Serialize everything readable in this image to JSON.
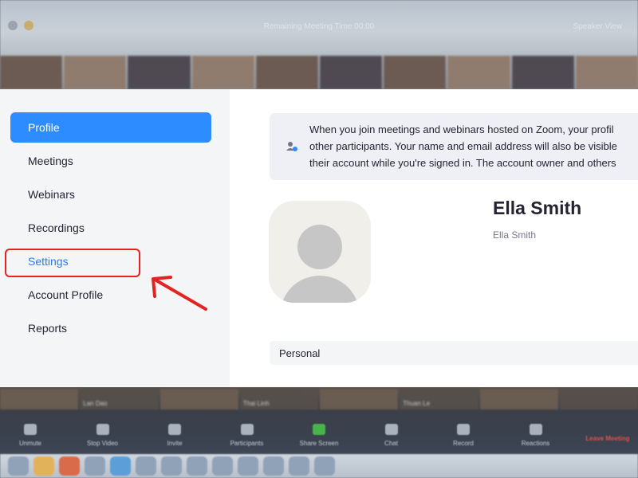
{
  "background": {
    "window_title": "Remaining Meeting Time 00:00",
    "view_label": "Speaker View",
    "strip_names": [
      "",
      "Lan Dao",
      "",
      "Thai Linh",
      "",
      "Thuan Le",
      "",
      ""
    ],
    "toolbar": [
      {
        "label": "Unmute",
        "icon": "mic-icon"
      },
      {
        "label": "Stop Video",
        "icon": "video-icon"
      },
      {
        "label": "Invite",
        "icon": "invite-icon"
      },
      {
        "label": "Participants",
        "icon": "participants-icon"
      },
      {
        "label": "Share Screen",
        "icon": "share-icon"
      },
      {
        "label": "Chat",
        "icon": "chat-icon"
      },
      {
        "label": "Record",
        "icon": "record-icon"
      },
      {
        "label": "Reactions",
        "icon": "reactions-icon"
      }
    ],
    "end_label": "Leave Meeting"
  },
  "sidebar": {
    "items": [
      {
        "label": "Profile",
        "active": true
      },
      {
        "label": "Meetings"
      },
      {
        "label": "Webinars"
      },
      {
        "label": "Recordings"
      },
      {
        "label": "Settings",
        "highlighted": true
      },
      {
        "label": "Account Profile"
      },
      {
        "label": "Reports"
      }
    ]
  },
  "main": {
    "banner_lines": [
      "When you join meetings and webinars hosted on Zoom, your profil",
      "other participants. Your name and email address will also be visible",
      "their account while you're signed in. The account owner and others"
    ],
    "display_name": "Ella Smith",
    "sub_name": "Ella Smith",
    "section_label": "Personal"
  },
  "colors": {
    "accent": "#2d8cff",
    "highlight": "#e32222",
    "text": "#232333"
  },
  "annotations": {
    "arrow_icon": "red-arrow-icon"
  }
}
